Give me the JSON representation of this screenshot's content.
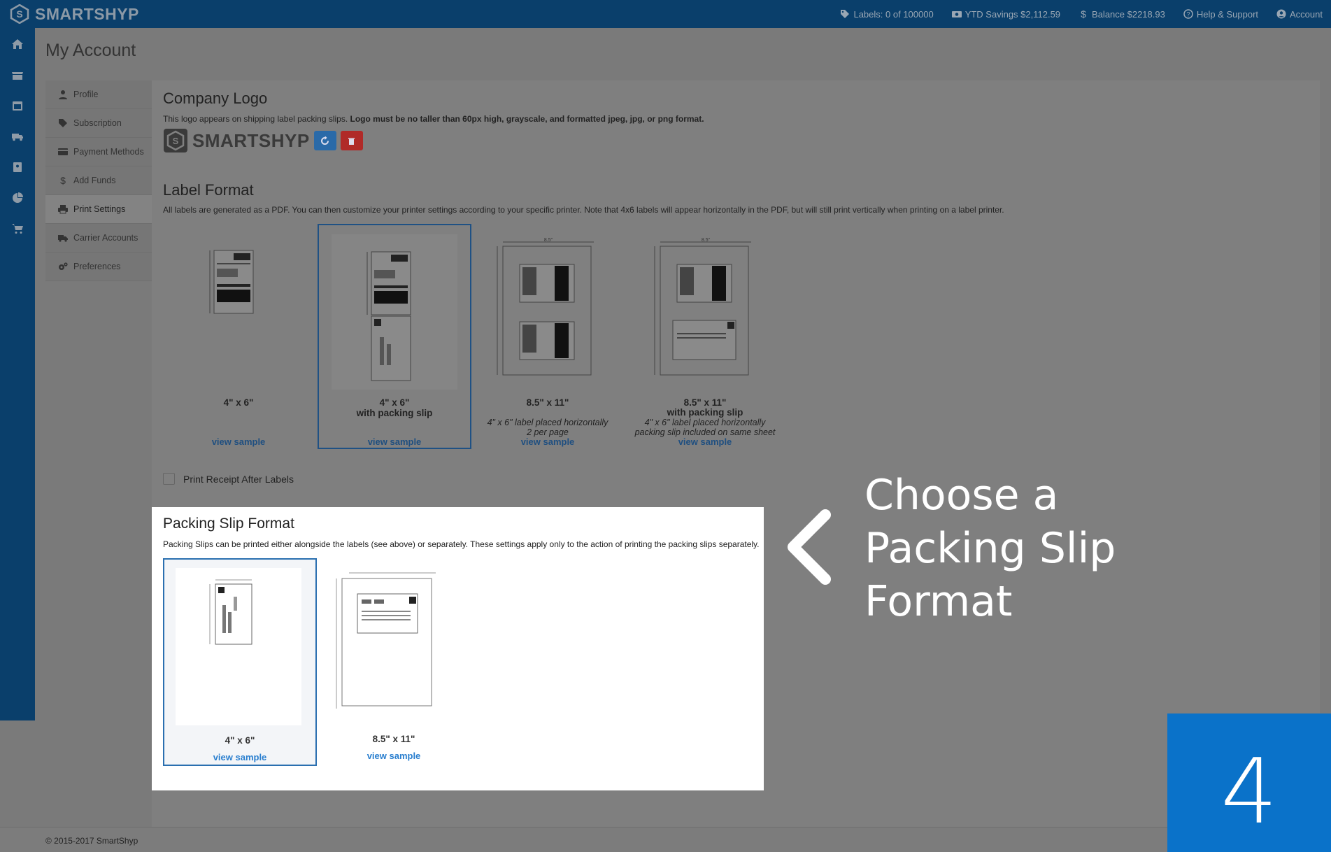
{
  "app": {
    "brand": "SMARTSHYP",
    "topbar": {
      "labels": "Labels: 0 of 100000",
      "ytd_savings": "YTD Savings $2,112.59",
      "balance": "Balance $2218.93",
      "help": "Help & Support",
      "account": "Account"
    }
  },
  "page_title": "My Account",
  "sidemenu": [
    {
      "label": "Profile",
      "icon": "user-icon"
    },
    {
      "label": "Subscription",
      "icon": "tag-icon"
    },
    {
      "label": "Payment Methods",
      "icon": "credit-card-icon"
    },
    {
      "label": "Add Funds",
      "icon": "dollar-icon"
    },
    {
      "label": "Print Settings",
      "icon": "printer-icon",
      "active": true
    },
    {
      "label": "Carrier Accounts",
      "icon": "truck-icon"
    },
    {
      "label": "Preferences",
      "icon": "gears-icon"
    }
  ],
  "company_logo": {
    "heading": "Company Logo",
    "desc_normal": "This logo appears on shipping label packing slips. ",
    "desc_bold": "Logo must be no taller than 60px high, grayscale, and formatted jpeg, jpg, or png format.",
    "logo_text": "SMARTSHYP"
  },
  "label_format": {
    "heading": "Label Format",
    "desc": "All labels are generated as a PDF. You can then customize your printer settings according to your specific printer. Note that 4x6 labels will appear horizontally in the PDF, but will still print vertically when printing on a label printer.",
    "options": [
      {
        "title": "4\" x 6\"",
        "subtitle": "",
        "note1": "",
        "note2": "",
        "link": "view sample",
        "selected": false
      },
      {
        "title": "4\" x 6\"",
        "subtitle": "with packing slip",
        "note1": "",
        "note2": "",
        "link": "view sample",
        "selected": true
      },
      {
        "title": "8.5\" x 11\"",
        "subtitle": "",
        "note1": "4\" x 6\" label placed horizontally",
        "note2": "2 per page",
        "link": "view sample",
        "selected": false
      },
      {
        "title": "8.5\" x 11\"",
        "subtitle": "with packing slip",
        "note1": "4\" x 6\" label placed horizontally",
        "note2": "packing slip included on same sheet",
        "link": "view sample",
        "selected": false
      }
    ],
    "print_receipt_label": "Print Receipt After Labels"
  },
  "packing_slip": {
    "heading": "Packing Slip Format",
    "desc": "Packing Slips can be printed either alongside the labels (see above) or separately. These settings apply only to the action of printing the packing slips separately.",
    "options": [
      {
        "title": "4\" x 6\"",
        "link": "view sample",
        "selected": true
      },
      {
        "title": "8.5\" x 11\"",
        "link": "view sample",
        "selected": false
      }
    ]
  },
  "callout": {
    "line1": "Choose a",
    "line2": "Packing Slip",
    "line3": "Format"
  },
  "step_number": "4",
  "footer": "© 2015-2017 SmartShyp",
  "colors": {
    "topbar": "#0a3f6b",
    "accent": "#2a7fcf",
    "step": "#0a72c9"
  }
}
